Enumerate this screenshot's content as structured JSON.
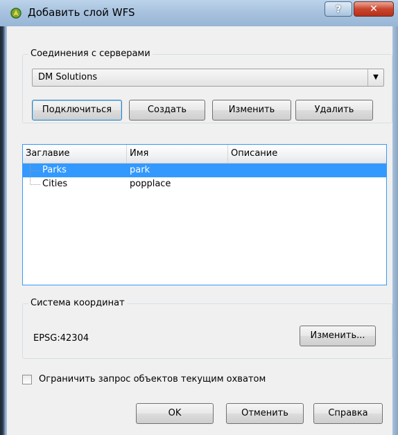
{
  "window": {
    "title": "Добавить слой WFS",
    "help_label": "?",
    "close_label": "✕"
  },
  "connections": {
    "group_title": "Соединения с серверами",
    "selected_server": "DM Solutions",
    "connect_label": "Подключиться",
    "create_label": "Создать",
    "edit_label": "Изменить",
    "delete_label": "Удалить"
  },
  "layers": {
    "columns": [
      "Заглавие",
      "Имя",
      "Описание"
    ],
    "rows": [
      {
        "title": "Parks",
        "name": "park",
        "description": "",
        "selected": true
      },
      {
        "title": "Cities",
        "name": "popplace",
        "description": "",
        "selected": false
      }
    ]
  },
  "crs": {
    "group_title": "Система координат",
    "value": "EPSG:42304",
    "change_label": "Изменить..."
  },
  "extent_checkbox": {
    "label": "Ограничить запрос объектов текущим охватом",
    "checked": false
  },
  "footer": {
    "ok_label": "OK",
    "cancel_label": "Отменить",
    "help_label": "Справка"
  },
  "colors": {
    "selection": "#3399ff",
    "titlebar": "#a6c1de",
    "close_button": "#c9452e"
  }
}
